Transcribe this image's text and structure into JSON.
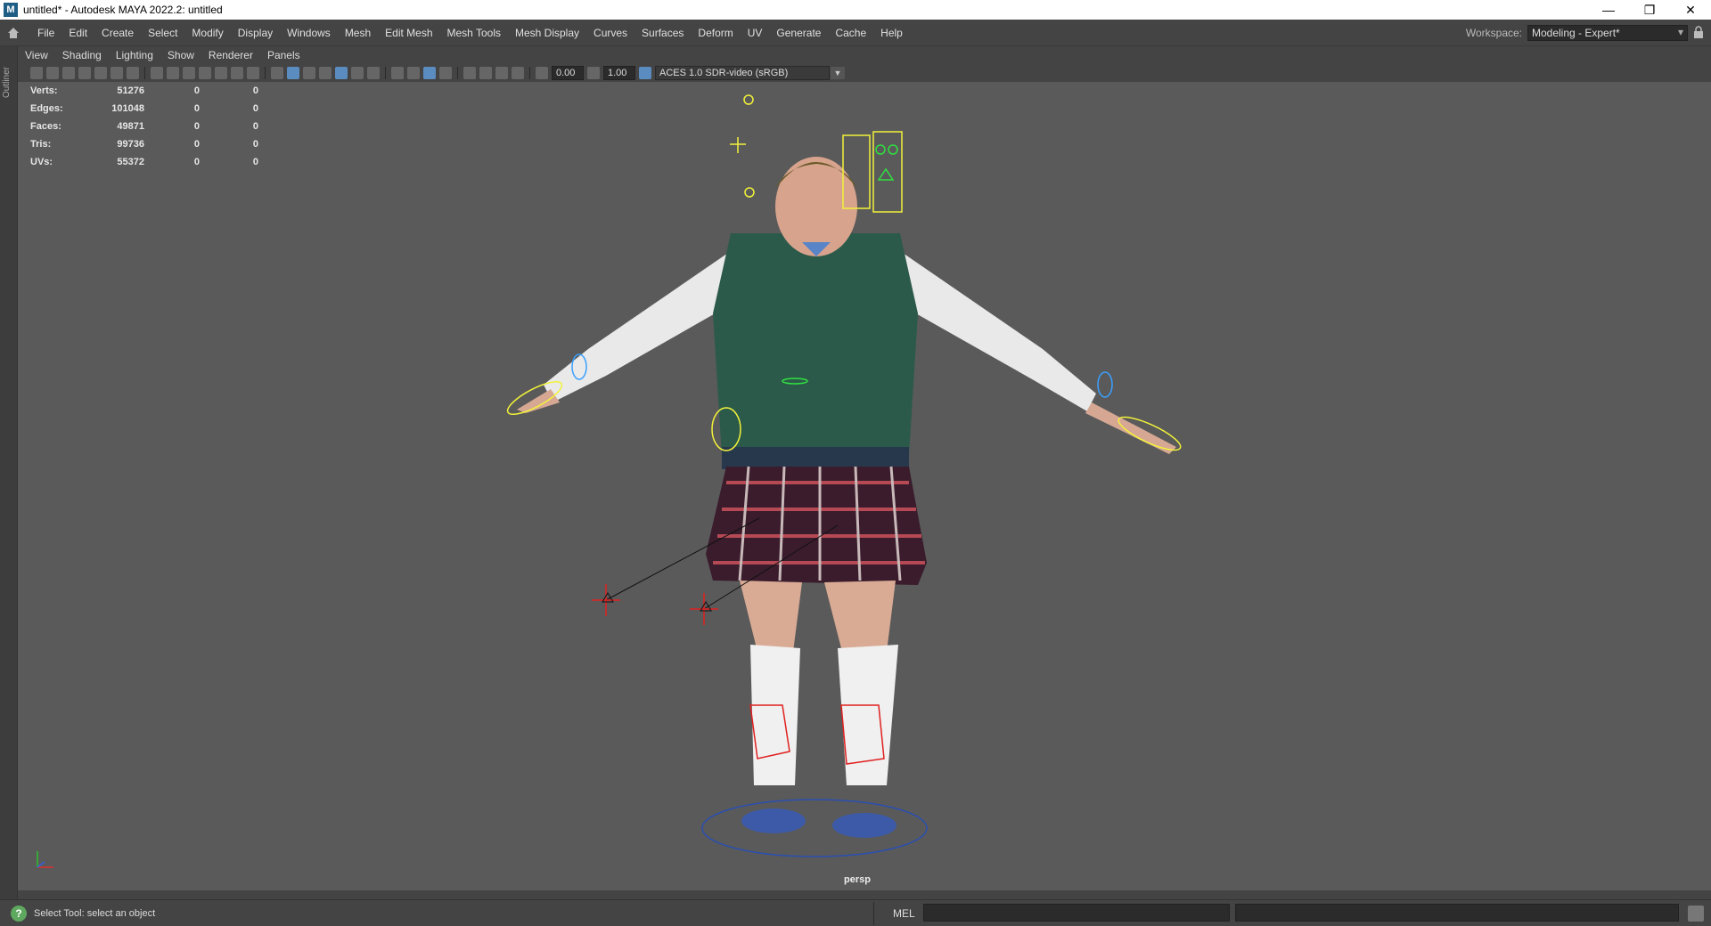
{
  "window": {
    "icon_letter": "M",
    "title": "untitled* - Autodesk MAYA 2022.2: untitled",
    "controls": [
      "—",
      "❐",
      "✕"
    ]
  },
  "menubar": {
    "items": [
      "File",
      "Edit",
      "Create",
      "Select",
      "Modify",
      "Display",
      "Windows",
      "Mesh",
      "Edit Mesh",
      "Mesh Tools",
      "Mesh Display",
      "Curves",
      "Surfaces",
      "Deform",
      "UV",
      "Generate",
      "Cache",
      "Help"
    ],
    "workspace_label": "Workspace:",
    "workspace_value": "Modeling - Expert*"
  },
  "outliner": {
    "label": "Outliner"
  },
  "panel_menu": {
    "items": [
      "View",
      "Shading",
      "Lighting",
      "Show",
      "Renderer",
      "Panels"
    ]
  },
  "toolbar": {
    "exposure": "0.00",
    "gamma": "1.00",
    "color_space": "ACES 1.0 SDR-video (sRGB)"
  },
  "hud": {
    "rows": [
      {
        "label": "Verts:",
        "v1": "51276",
        "v2": "0",
        "v3": "0"
      },
      {
        "label": "Edges:",
        "v1": "101048",
        "v2": "0",
        "v3": "0"
      },
      {
        "label": "Faces:",
        "v1": "49871",
        "v2": "0",
        "v3": "0"
      },
      {
        "label": "Tris:",
        "v1": "99736",
        "v2": "0",
        "v3": "0"
      },
      {
        "label": "UVs:",
        "v1": "55372",
        "v2": "0",
        "v3": "0"
      }
    ]
  },
  "viewport": {
    "camera": "persp"
  },
  "statusbar": {
    "help_text": "Select Tool: select an object",
    "mel_label": "MEL"
  },
  "colors": {
    "viewport_bg": "#5a5a5a",
    "ui_bg": "#444444",
    "rig_yellow": "#f2f23a",
    "rig_blue": "#3aa0ff",
    "rig_red": "#e02020",
    "rig_green": "#30e040"
  }
}
